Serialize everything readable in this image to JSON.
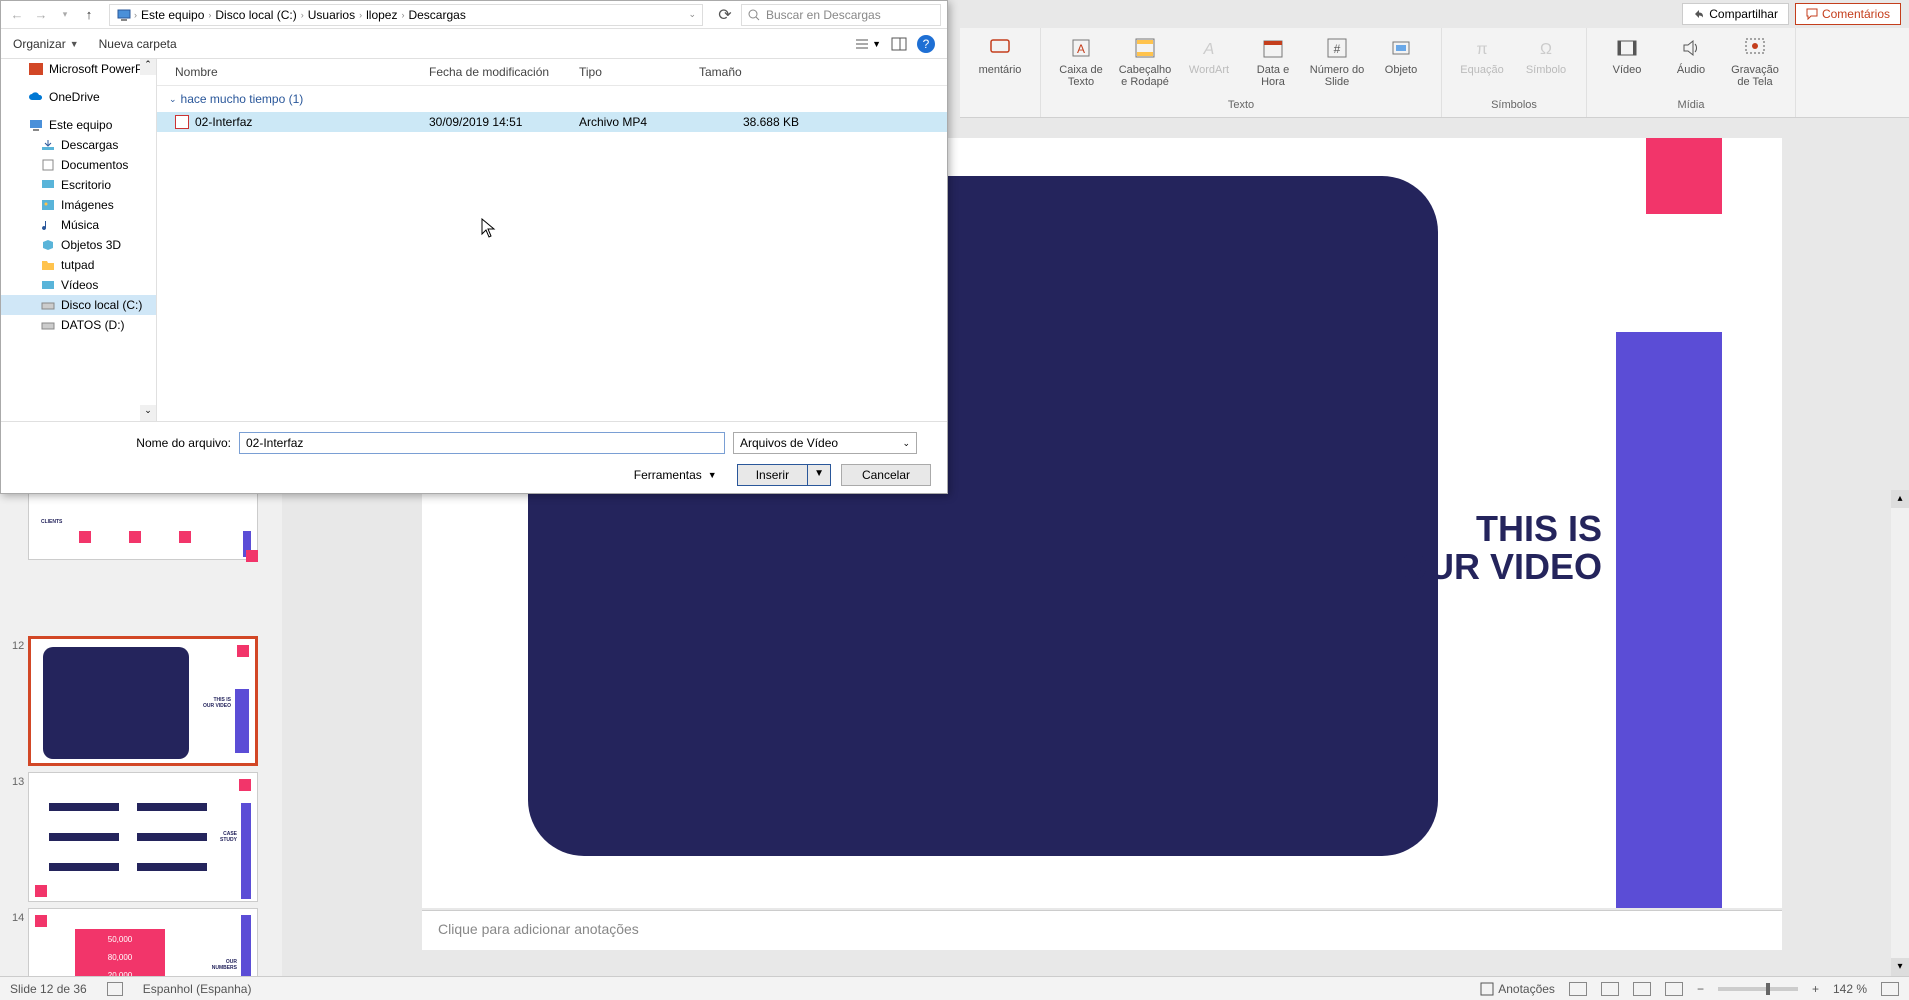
{
  "topbar": {
    "share": "Compartilhar",
    "comments": "Comentários"
  },
  "ribbon": {
    "groups": {
      "partial_left": "mentário",
      "texto": {
        "label": "Texto",
        "caixa": "Caixa de Texto",
        "cabecalho": "Cabeçalho e Rodapé",
        "wordart": "WordArt",
        "data": "Data e Hora",
        "numero": "Número do Slide",
        "objeto": "Objeto"
      },
      "simbolos": {
        "label": "Símbolos",
        "equacao": "Equação",
        "simbolo": "Símbolo"
      },
      "midia": {
        "label": "Mídia",
        "video": "Vídeo",
        "audio": "Áudio",
        "gravacao": "Gravação de Tela"
      }
    }
  },
  "slide": {
    "text_line1": "THIS IS",
    "text_line2": "OUR VIDEO",
    "notes_placeholder": "Clique para adicionar anotações"
  },
  "thumbnails": {
    "current_num": "12",
    "next_num": "13",
    "after_num": "14",
    "t12_text1": "THIS IS",
    "t12_text2": "OUR VIDEO"
  },
  "statusbar": {
    "slide_info": "Slide 12 de 36",
    "language": "Espanhol (Espanha)",
    "notes": "Anotações",
    "zoom": "142 %"
  },
  "dialog": {
    "nav": {
      "breadcrumb": [
        "Este equipo",
        "Disco local (C:)",
        "Usuarios",
        "llopez",
        "Descargas"
      ],
      "search_placeholder": "Buscar en Descargas"
    },
    "toolbar": {
      "organize": "Organizar",
      "new_folder": "Nueva carpeta"
    },
    "sidebar": [
      {
        "label": "Microsoft PowerP",
        "icon": "pp"
      },
      {
        "label": "OneDrive",
        "icon": "cloud"
      },
      {
        "label": "Este equipo",
        "icon": "pc"
      },
      {
        "label": "Descargas",
        "icon": "folder"
      },
      {
        "label": "Documentos",
        "icon": "folder"
      },
      {
        "label": "Escritorio",
        "icon": "folder"
      },
      {
        "label": "Imágenes",
        "icon": "folder"
      },
      {
        "label": "Música",
        "icon": "folder"
      },
      {
        "label": "Objetos 3D",
        "icon": "folder"
      },
      {
        "label": "tutpad",
        "icon": "folder"
      },
      {
        "label": "Vídeos",
        "icon": "folder"
      },
      {
        "label": "Disco local (C:)",
        "icon": "drive",
        "selected": true
      },
      {
        "label": "DATOS (D:)",
        "icon": "drive"
      }
    ],
    "columns": {
      "name": "Nombre",
      "date": "Fecha de modificación",
      "type": "Tipo",
      "size": "Tamaño"
    },
    "group_label": "hace mucho tiempo (1)",
    "file": {
      "name": "02-Interfaz",
      "date": "30/09/2019 14:51",
      "type": "Archivo MP4",
      "size": "38.688 KB"
    },
    "bottom": {
      "filename_label": "Nome do arquivo:",
      "filename_value": "02-Interfaz",
      "filetype": "Arquivos de Vídeo",
      "tools": "Ferramentas",
      "insert": "Inserir",
      "cancel": "Cancelar"
    }
  }
}
